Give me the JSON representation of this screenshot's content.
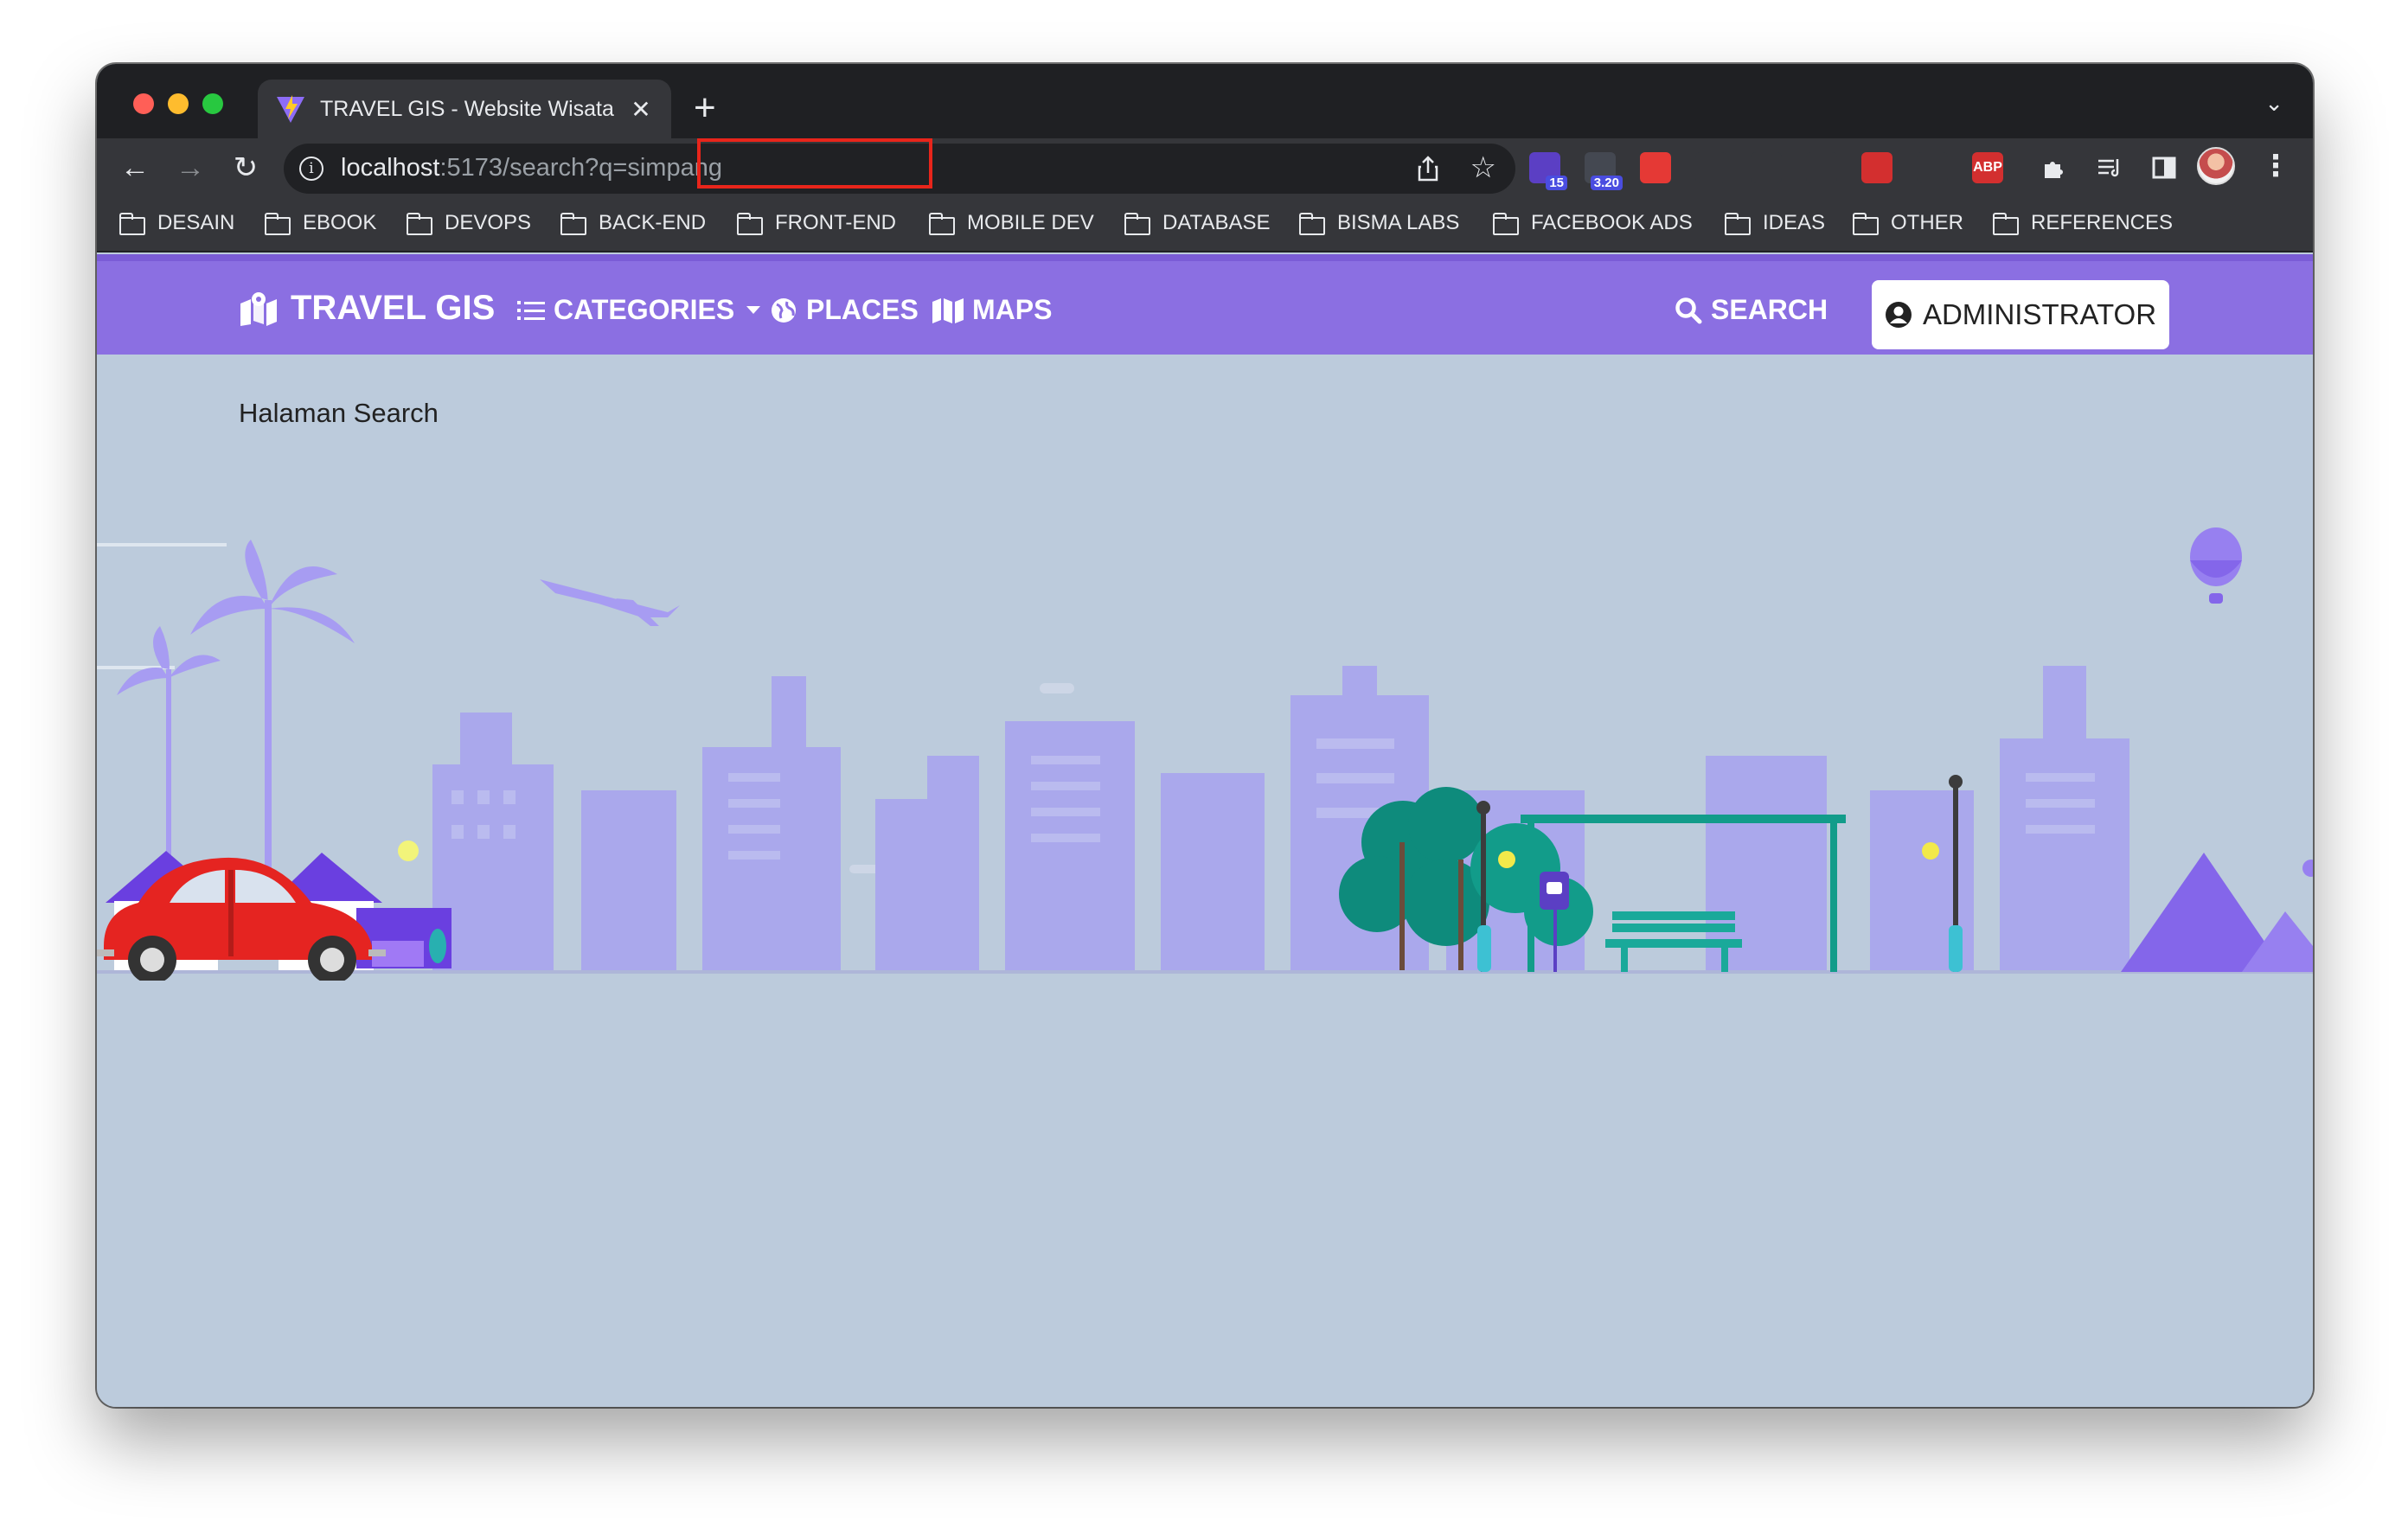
{
  "browser": {
    "tab_title": "TRAVEL GIS - Website Wisata I",
    "tab_close": "✕",
    "new_tab": "+",
    "url_host": "localhost",
    "url_port": ":5173/",
    "url_path": "search?q=simpang",
    "extensions": [
      {
        "name": "extension-purple",
        "badge": "15",
        "color": "#5b3fc4"
      },
      {
        "name": "extension-dark",
        "badge": "3.20",
        "color": "#444851"
      },
      {
        "name": "extension-red",
        "color": "#e53935"
      },
      {
        "name": "extension-info",
        "color": "#35363a"
      },
      {
        "name": "extension-v1",
        "color": "#35363a"
      },
      {
        "name": "extension-v2",
        "color": "#35363a"
      },
      {
        "name": "extension-ninja",
        "color": "#d32f2f"
      },
      {
        "name": "extension-colorpicker",
        "color": "#35363a"
      },
      {
        "name": "extension-adblock",
        "label": "ABP",
        "color": "#d32f2f"
      }
    ]
  },
  "bookmarks": [
    "DESAIN",
    "EBOOK",
    "DEVOPS",
    "BACK-END",
    "FRONT-END",
    "MOBILE DEV",
    "DATABASE",
    "BISMA LABS",
    "FACEBOOK ADS",
    "IDEAS",
    "OTHER",
    "REFERENCES"
  ],
  "navbar": {
    "brand": "TRAVEL GIS",
    "categories": "CATEGORIES",
    "places": "PLACES",
    "maps": "MAPS",
    "search": "SEARCH",
    "admin": "ADMINISTRATOR"
  },
  "page": {
    "heading": "Halaman Search"
  },
  "colors": {
    "navbar": "#8b6fe2",
    "page_bg": "#bccbdc",
    "highlight": "#e8251b"
  }
}
